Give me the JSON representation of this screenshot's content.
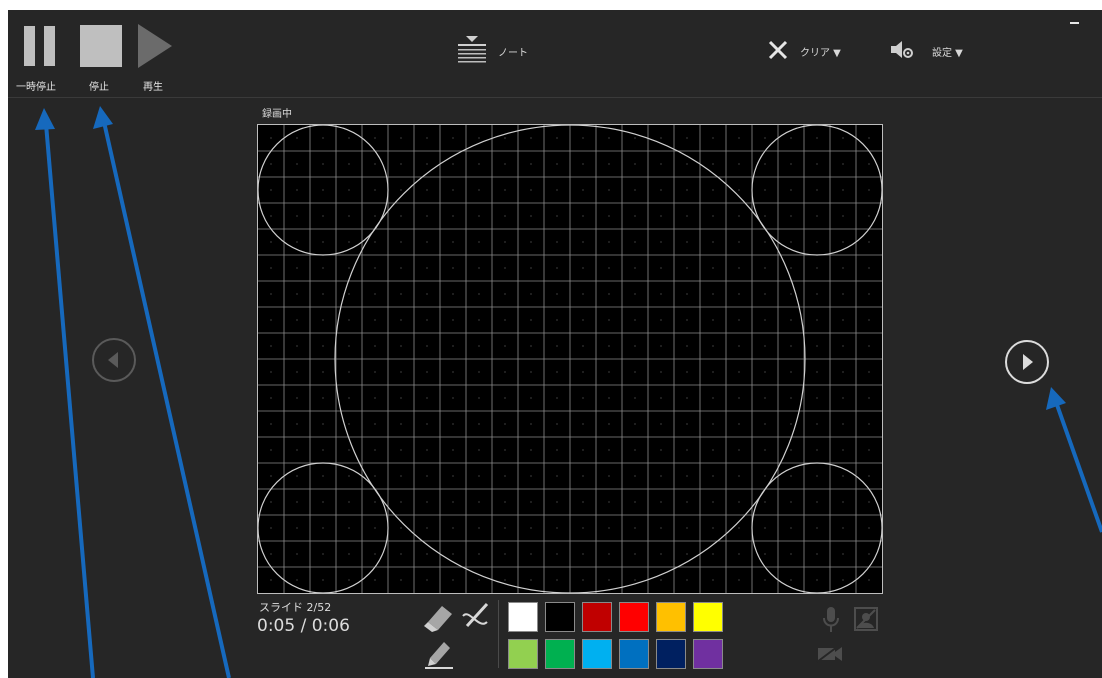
{
  "toolbar": {
    "pause_label": "一時停止",
    "stop_label": "停止",
    "play_label": "再生",
    "notes_label": "ノート",
    "clear_label": "クリア ▼",
    "settings_label": "設定 ▼"
  },
  "recording_status": "録画中",
  "slide_counter": "スライド 2/52",
  "timer": "0:05 / 0:06",
  "colors": {
    "background": "#262626",
    "annotation_arrow": "#1669bd"
  },
  "palette": {
    "row1": [
      "#ffffff",
      "#000000",
      "#c00000",
      "#ff0000",
      "#ffc000",
      "#ffff00"
    ],
    "row2": [
      "#92d050",
      "#00b050",
      "#00b0f0",
      "#0070c0",
      "#002060",
      "#7030a0"
    ]
  },
  "icons": {
    "pause": "pause-icon",
    "stop": "stop-icon",
    "play": "play-icon",
    "notes": "notes-icon",
    "clear": "close-icon",
    "settings": "speaker-gear-icon",
    "prev": "chevron-left-circle-icon",
    "next": "chevron-right-circle-icon",
    "eraser": "eraser-icon",
    "pen": "pen-icon",
    "highlighter": "highlighter-icon",
    "microphone": "microphone-icon",
    "camera_off": "camera-off-icon",
    "camera_preview_off": "camera-preview-off-icon",
    "minimize": "minimize-icon"
  }
}
